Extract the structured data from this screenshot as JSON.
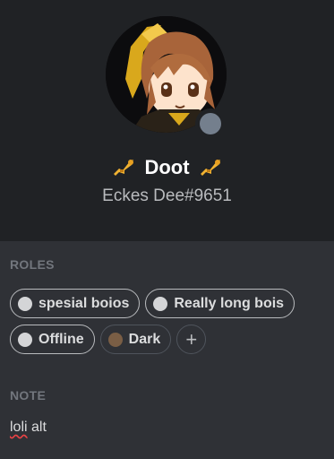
{
  "profile": {
    "display_name": "Doot",
    "tag": "Eckes Dee#9651",
    "status": "offline",
    "status_color": "#747f8d",
    "name_icon": "trumpet-icon"
  },
  "roles": {
    "title": "ROLES",
    "items": [
      {
        "label": "spesial boios",
        "color": "#d4d5d7"
      },
      {
        "label": "Really long bois",
        "color": "#d4d5d7"
      },
      {
        "label": "Offline",
        "color": "#d4d5d7"
      },
      {
        "label": "Dark",
        "color": "#7a5e45"
      }
    ],
    "add_icon": "plus-icon"
  },
  "note": {
    "title": "NOTE",
    "text_underlined": "loli",
    "text_rest": " alt"
  },
  "colors": {
    "header_bg": "#202225",
    "body_bg": "#2f3136"
  }
}
